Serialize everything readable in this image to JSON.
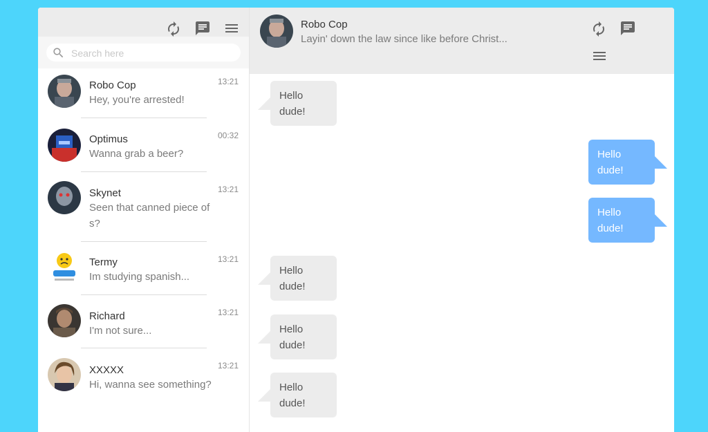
{
  "sidebar": {
    "search_placeholder": "Search here",
    "contacts": [
      {
        "name": "Robo Cop",
        "preview": "Hey, you're arrested!",
        "time": "13:21"
      },
      {
        "name": "Optimus",
        "preview": "Wanna grab a beer?",
        "time": "00:32"
      },
      {
        "name": "Skynet",
        "preview": "Seen that canned piece of s?",
        "time": "13:21"
      },
      {
        "name": "Termy",
        "preview": "Im studying spanish...",
        "time": "13:21"
      },
      {
        "name": "Richard",
        "preview": "I'm not sure...",
        "time": "13:21"
      },
      {
        "name": "XXXXX",
        "preview": "Hi, wanna see something?",
        "time": "13:21"
      }
    ],
    "icons": [
      "refresh-icon",
      "message-icon",
      "menu-icon"
    ]
  },
  "chat": {
    "name": "Robo Cop",
    "status": "Layin' down the law since like before Christ...",
    "icons": [
      "refresh-icon",
      "message-icon",
      "menu-icon"
    ],
    "messages": [
      {
        "direction": "in",
        "text": "Hello dude!"
      },
      {
        "direction": "out",
        "text": "Hello dude!"
      },
      {
        "direction": "out",
        "text": "Hello dude!"
      },
      {
        "direction": "in",
        "text": "Hello dude!"
      },
      {
        "direction": "in",
        "text": "Hello dude!"
      },
      {
        "direction": "in",
        "text": "Hello dude!"
      }
    ]
  },
  "colors": {
    "background": "#4dd5fb",
    "outgoing_bubble": "#75b8ff",
    "incoming_bubble": "#ececec",
    "header": "#ececec"
  }
}
